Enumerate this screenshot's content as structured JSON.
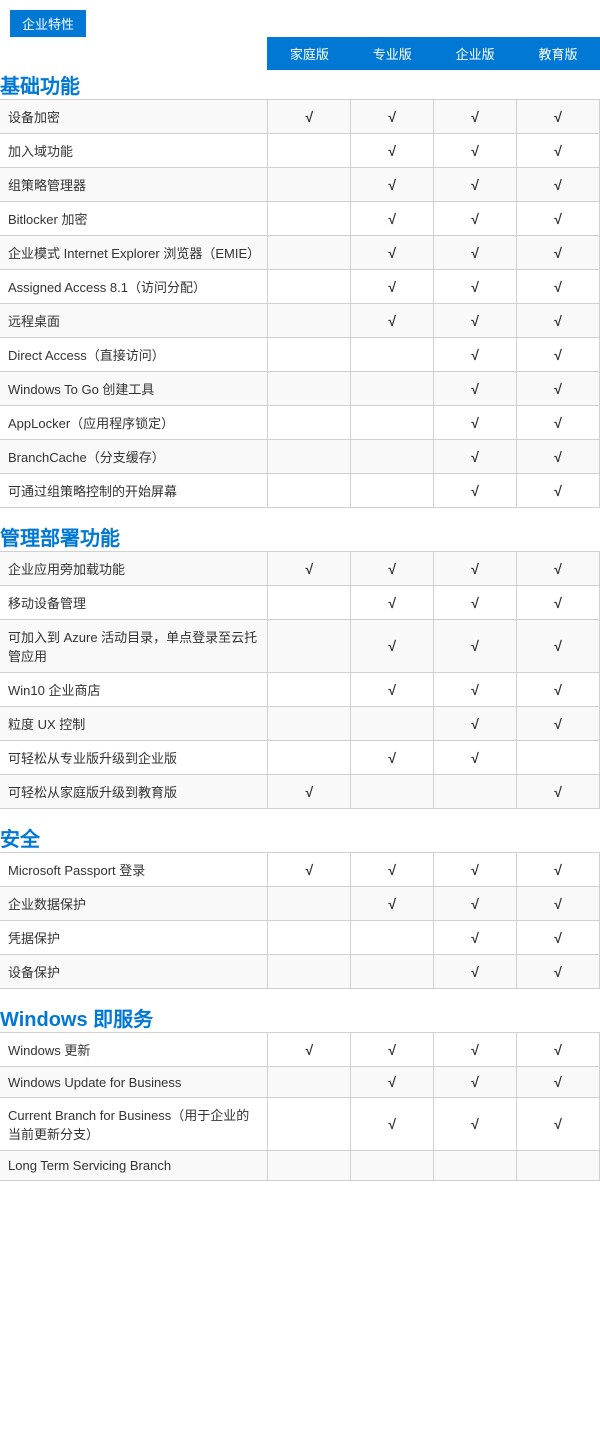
{
  "badge": "企业特性",
  "columns": {
    "headers": [
      "家庭版",
      "专业版",
      "企业版",
      "教育版"
    ]
  },
  "sections": [
    {
      "id": "basic",
      "title": "基础功能",
      "rows": [
        {
          "feature": "设备加密",
          "home": true,
          "pro": true,
          "ent": true,
          "edu": true
        },
        {
          "feature": "加入域功能",
          "home": false,
          "pro": true,
          "ent": true,
          "edu": true
        },
        {
          "feature": "组策略管理器",
          "home": false,
          "pro": true,
          "ent": true,
          "edu": true
        },
        {
          "feature": "Bitlocker 加密",
          "home": false,
          "pro": true,
          "ent": true,
          "edu": true
        },
        {
          "feature": "企业模式 Internet Explorer 浏览器（EMIE）",
          "home": false,
          "pro": true,
          "ent": true,
          "edu": true
        },
        {
          "feature": "Assigned Access 8.1（访问分配）",
          "home": false,
          "pro": true,
          "ent": true,
          "edu": true
        },
        {
          "feature": "远程桌面",
          "home": false,
          "pro": true,
          "ent": true,
          "edu": true
        },
        {
          "feature": "Direct Access（直接访问）",
          "home": false,
          "pro": false,
          "ent": true,
          "edu": true
        },
        {
          "feature": "Windows To Go 创建工具",
          "home": false,
          "pro": false,
          "ent": true,
          "edu": true
        },
        {
          "feature": "AppLocker（应用程序锁定）",
          "home": false,
          "pro": false,
          "ent": true,
          "edu": true
        },
        {
          "feature": "BranchCache（分支缓存）",
          "home": false,
          "pro": false,
          "ent": true,
          "edu": true
        },
        {
          "feature": "可通过组策略控制的开始屏幕",
          "home": false,
          "pro": false,
          "ent": true,
          "edu": true
        }
      ]
    },
    {
      "id": "mgmt",
      "title": "管理部署功能",
      "rows": [
        {
          "feature": "企业应用旁加载功能",
          "home": true,
          "pro": true,
          "ent": true,
          "edu": true
        },
        {
          "feature": "移动设备管理",
          "home": false,
          "pro": true,
          "ent": true,
          "edu": true
        },
        {
          "feature": "可加入到 Azure 活动目录，单点登录至云托管应用",
          "home": false,
          "pro": true,
          "ent": true,
          "edu": true
        },
        {
          "feature": "Win10 企业商店",
          "home": false,
          "pro": true,
          "ent": true,
          "edu": true
        },
        {
          "feature": "粒度 UX 控制",
          "home": false,
          "pro": false,
          "ent": true,
          "edu": true
        },
        {
          "feature": "可轻松从专业版升级到企业版",
          "home": false,
          "pro": true,
          "ent": true,
          "edu": false
        },
        {
          "feature": "可轻松从家庭版升级到教育版",
          "home": true,
          "pro": false,
          "ent": false,
          "edu": true
        }
      ]
    },
    {
      "id": "security",
      "title": "安全",
      "rows": [
        {
          "feature": "Microsoft Passport 登录",
          "home": true,
          "pro": true,
          "ent": true,
          "edu": true
        },
        {
          "feature": "企业数据保护",
          "home": false,
          "pro": true,
          "ent": true,
          "edu": true
        },
        {
          "feature": "凭据保护",
          "home": false,
          "pro": false,
          "ent": true,
          "edu": true
        },
        {
          "feature": "设备保护",
          "home": false,
          "pro": false,
          "ent": true,
          "edu": true
        }
      ]
    },
    {
      "id": "windows-service",
      "title": "Windows 即服务",
      "rows": [
        {
          "feature": "Windows 更新",
          "home": true,
          "pro": true,
          "ent": true,
          "edu": true
        },
        {
          "feature": "Windows Update for Business",
          "home": false,
          "pro": true,
          "ent": true,
          "edu": true
        },
        {
          "feature": "Current Branch for Business（用于企业的当前更新分支）",
          "home": false,
          "pro": true,
          "ent": true,
          "edu": true
        },
        {
          "feature": "Long Term Servicing Branch",
          "home": false,
          "pro": false,
          "ent": false,
          "edu": false
        }
      ]
    }
  ]
}
